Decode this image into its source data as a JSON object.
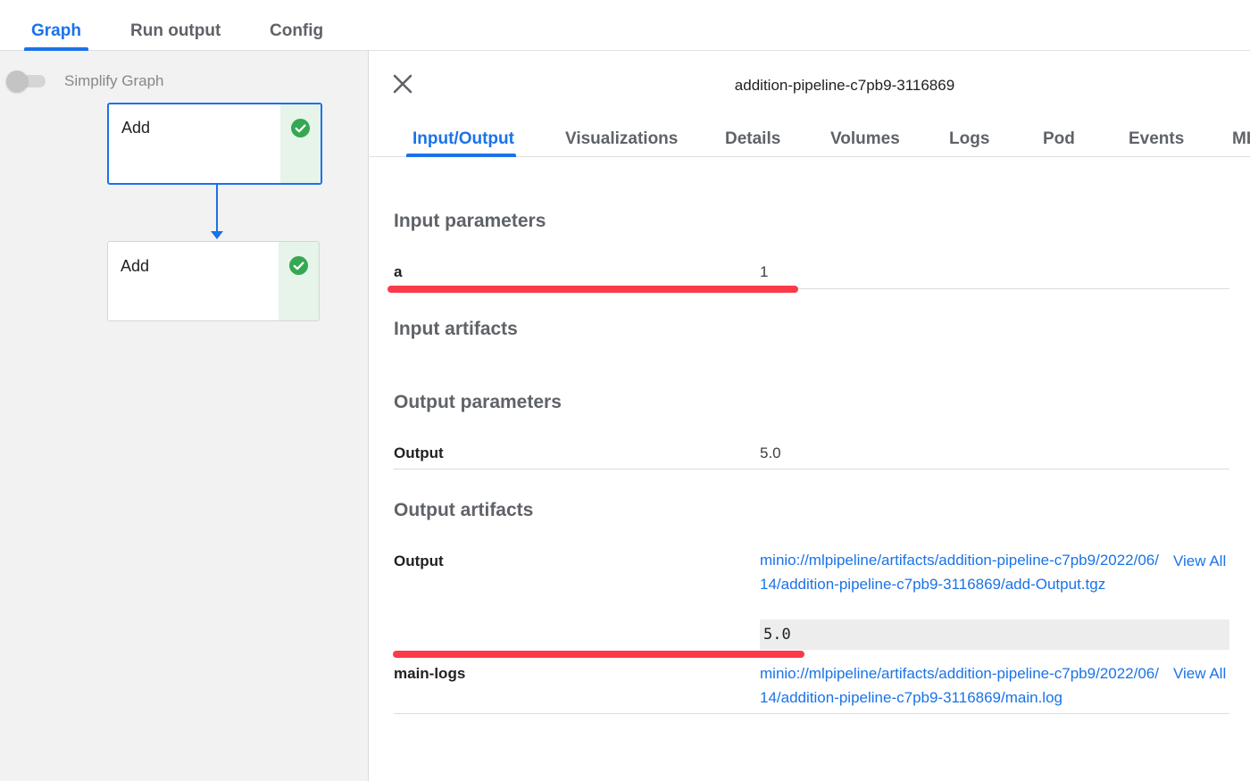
{
  "top_tabs": {
    "graph": "Graph",
    "run_output": "Run output",
    "config": "Config"
  },
  "graph": {
    "simplify_label": "Simplify Graph",
    "simplify_enabled": false,
    "nodes": [
      {
        "label": "Add",
        "status": "succeeded",
        "selected": true
      },
      {
        "label": "Add",
        "status": "succeeded",
        "selected": false
      }
    ]
  },
  "details": {
    "title": "addition-pipeline-c7pb9-3116869",
    "tabs": [
      "Input/Output",
      "Visualizations",
      "Details",
      "Volumes",
      "Logs",
      "Pod",
      "Events",
      "ML Metadata"
    ],
    "active_tab": "Input/Output",
    "input_parameters": {
      "title": "Input parameters",
      "rows": [
        {
          "key": "a",
          "value": "1"
        }
      ]
    },
    "input_artifacts": {
      "title": "Input artifacts"
    },
    "output_parameters": {
      "title": "Output parameters",
      "rows": [
        {
          "key": "Output",
          "value": "5.0"
        }
      ]
    },
    "output_artifacts": {
      "title": "Output artifacts",
      "rows": [
        {
          "key": "Output",
          "uri": "minio://mlpipeline/artifacts/addition-pipeline-c7pb9/2022/06/14/addition-pipeline-c7pb9-3116869/add-Output.tgz",
          "view_all": "View All",
          "preview": "5.0"
        },
        {
          "key": "main-logs",
          "uri": "minio://mlpipeline/artifacts/addition-pipeline-c7pb9/2022/06/14/addition-pipeline-c7pb9-3116869/main.log",
          "view_all": "View All"
        }
      ]
    }
  },
  "colors": {
    "accent": "#1a73e8",
    "success": "#34a853",
    "annotation": "#fb3a4a"
  }
}
